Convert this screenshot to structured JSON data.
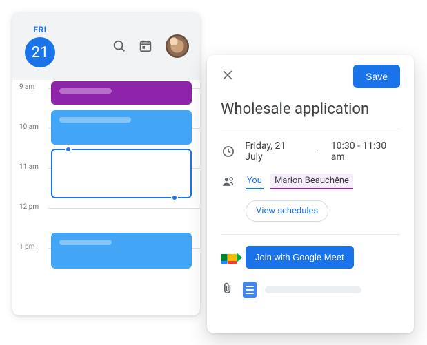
{
  "calendar": {
    "day_label": "FRI",
    "date_number": "21",
    "hours": [
      "9 am",
      "10 am",
      "11 am",
      "12 pm",
      "1 pm"
    ]
  },
  "detail": {
    "save_label": "Save",
    "title": "Wholesale application",
    "date_text": "Friday, 21 July",
    "time_text": "10:30 - 11:30 am",
    "you_chip": "You",
    "guest_chip": "Marion Beauchêne",
    "view_schedules": "View schedules",
    "meet_button": "Join with Google Meet"
  },
  "icons": {
    "search": "search-icon",
    "today": "calendar-today-icon",
    "close": "close-icon",
    "clock": "clock-icon",
    "people": "people-icon",
    "clip": "attachment-icon",
    "doc": "docs-icon",
    "meet": "google-meet-icon"
  }
}
